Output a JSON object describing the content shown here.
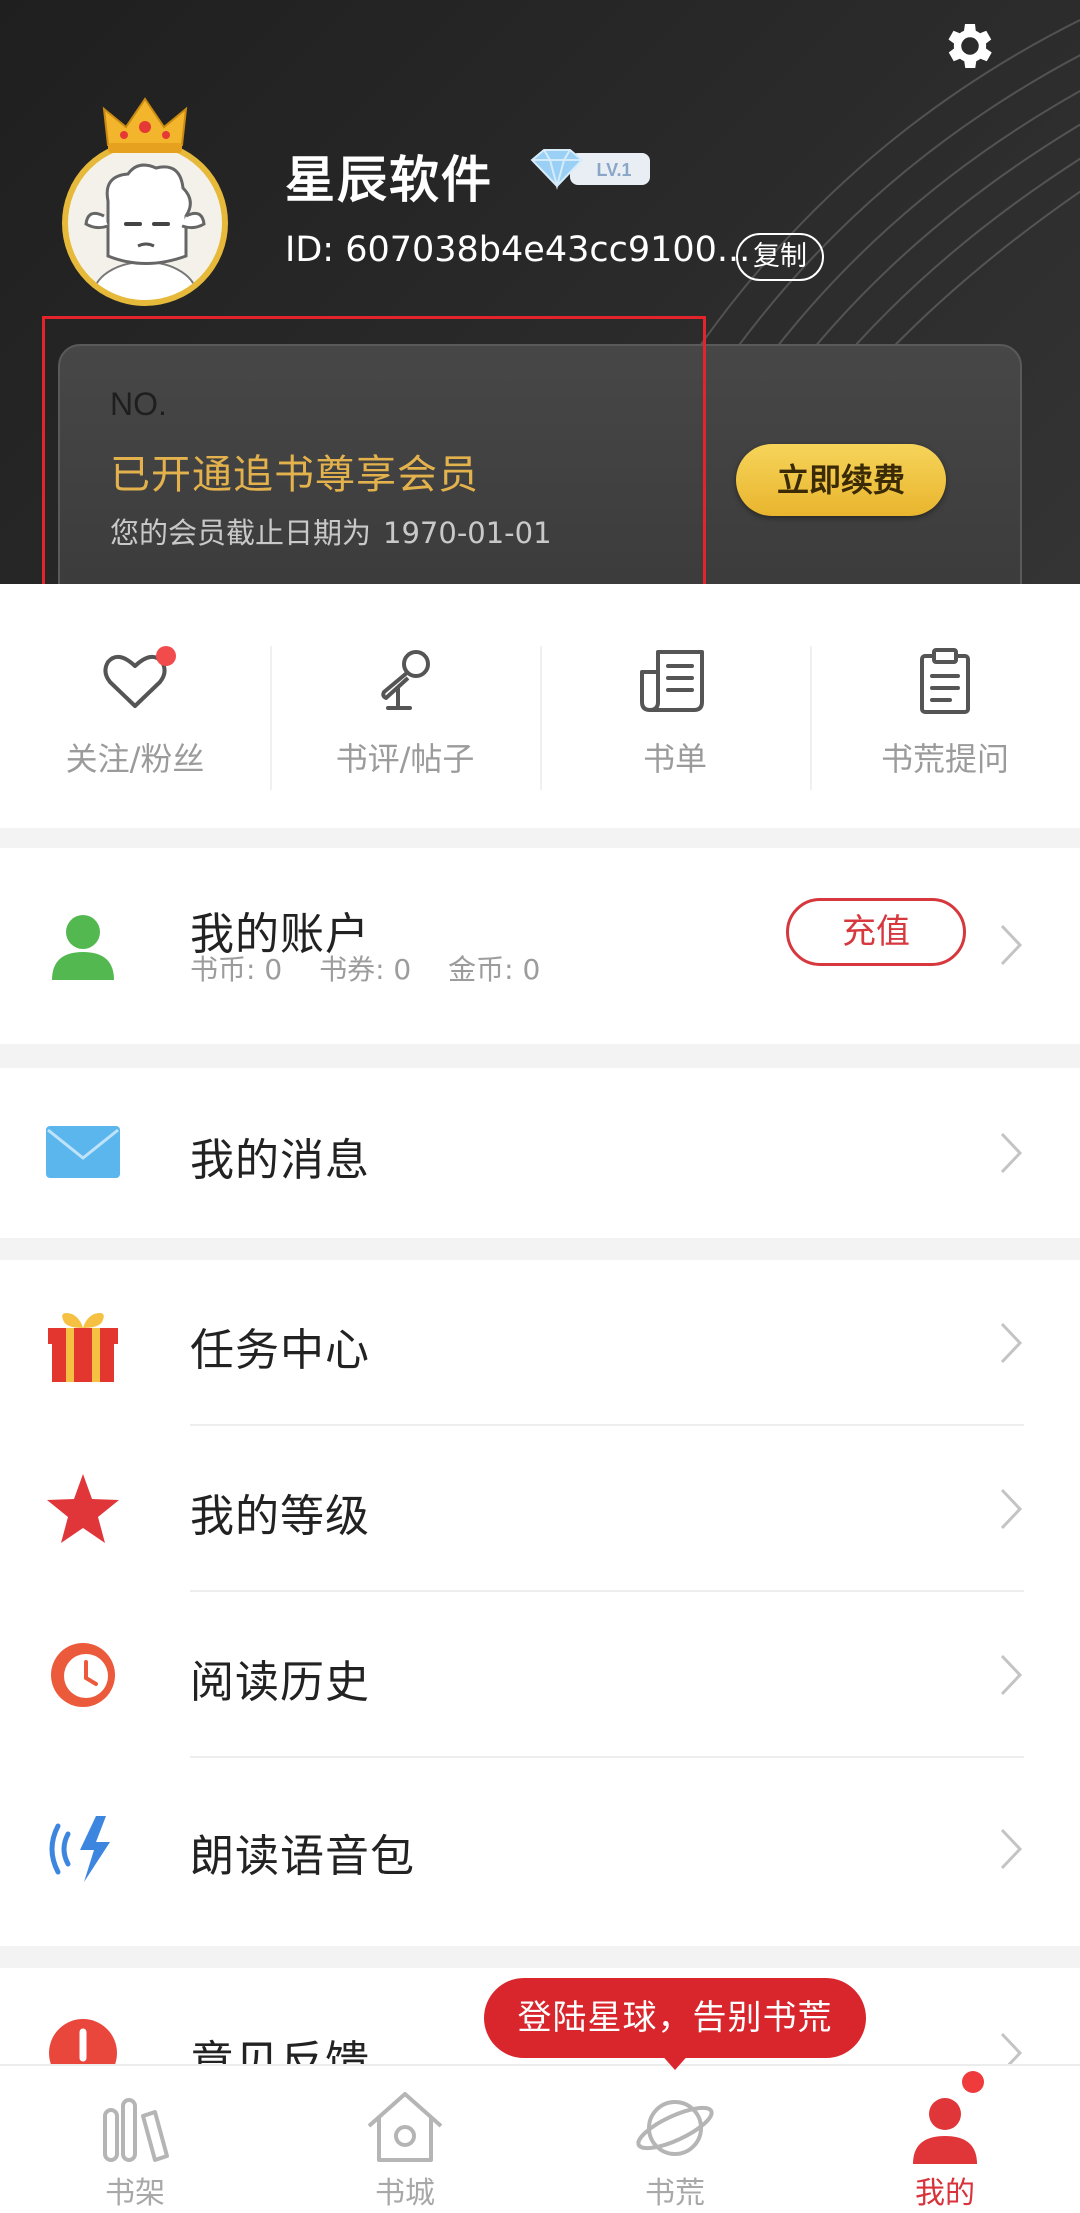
{
  "profile": {
    "username": "星辰软件",
    "level": "LV.1",
    "user_id": "ID: 607038b4e43cc9100...",
    "copy_label": "复制"
  },
  "vip": {
    "no_label": "NO.",
    "title": "已开通追书尊享会员",
    "expire_label": "您的会员截止日期为",
    "expire_date": "1970-01-01",
    "renew_label": "立即续费"
  },
  "quick_actions": [
    {
      "label": "关注/粉丝",
      "icon": "heart-icon"
    },
    {
      "label": "书评/帖子",
      "icon": "microphone-icon"
    },
    {
      "label": "书单",
      "icon": "booklist-icon"
    },
    {
      "label": "书荒提问",
      "icon": "clipboard-icon"
    }
  ],
  "account": {
    "title": "我的账户",
    "book_coins": "书币: 0",
    "book_coupons": "书券: 0",
    "gold_coins": "金币: 0",
    "recharge_label": "充值"
  },
  "menu": {
    "messages": "我的消息",
    "task_center": "任务中心",
    "my_level": "我的等级",
    "reading_history": "阅读历史",
    "voice_pack": "朗读语音包",
    "feedback": "意见反馈"
  },
  "bubble": "登陆星球，告别书荒",
  "bottom_nav": [
    {
      "label": "书架",
      "icon": "bookshelf-icon"
    },
    {
      "label": "书城",
      "icon": "home-icon"
    },
    {
      "label": "书荒",
      "icon": "planet-icon"
    },
    {
      "label": "我的",
      "icon": "person-icon",
      "active": true
    }
  ],
  "colors": {
    "accent_red": "#d8323a",
    "vip_gold": "#e3b24d",
    "header_bg": "#262626"
  }
}
